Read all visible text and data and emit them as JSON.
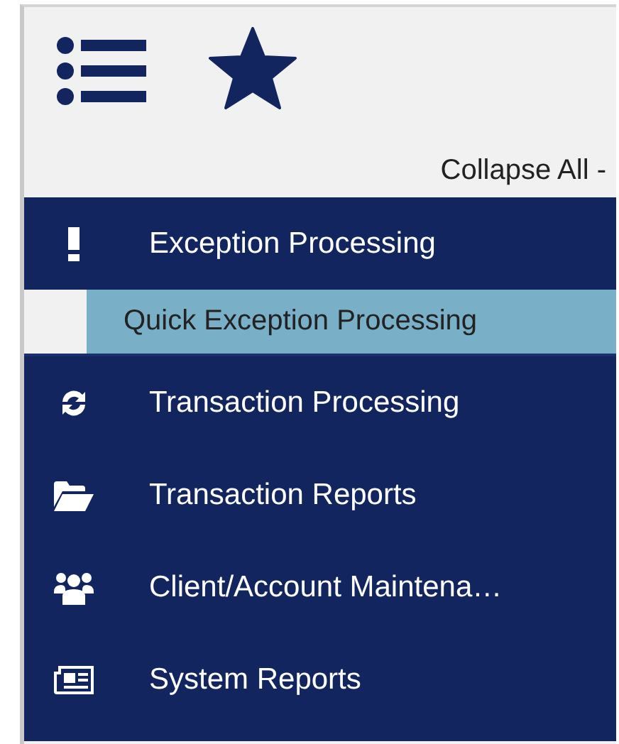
{
  "toolbar": {
    "collapse_label": "Collapse All -"
  },
  "menu": [
    {
      "label": "Exception Processing",
      "children": [
        {
          "label": "Quick Exception Processing",
          "selected": true
        }
      ]
    },
    {
      "label": "Transaction Processing"
    },
    {
      "label": "Transaction Reports"
    },
    {
      "label": "Client/Account Maintena…"
    },
    {
      "label": "System Reports"
    }
  ]
}
